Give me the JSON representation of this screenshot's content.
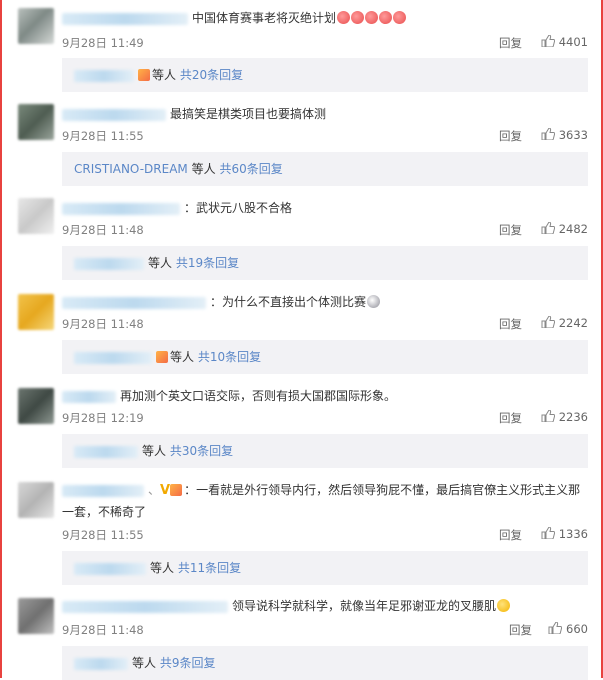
{
  "comments": [
    {
      "text": "中国体育赛事老将灭绝计划",
      "time": "9月28日 11:49",
      "reply_label": "回复",
      "likes": "4401",
      "sub": {
        "name": "",
        "suffix": "等人",
        "link": "共20条回复"
      }
    },
    {
      "text": "最搞笑是棋类项目也要搞体测",
      "time": "9月28日 11:55",
      "reply_label": "回复",
      "likes": "3633",
      "sub": {
        "name": "CRISTIANO-DREAM",
        "suffix": "等人",
        "link": "共60条回复"
      }
    },
    {
      "text": "：武状元八股不合格",
      "time": "9月28日 11:48",
      "reply_label": "回复",
      "likes": "2482",
      "sub": {
        "name": "",
        "suffix": "等人",
        "link": "共19条回复"
      }
    },
    {
      "text": "：为什么不直接出个体测比赛",
      "time": "9月28日 11:48",
      "reply_label": "回复",
      "likes": "2242",
      "sub": {
        "name": "",
        "suffix": "等人",
        "link": "共10条回复"
      }
    },
    {
      "text": "再加测个英文口语交际，否则有损大国郡国际形象。",
      "time": "9月28日 12:19",
      "reply_label": "回复",
      "likes": "2236",
      "sub": {
        "name": "",
        "suffix": "等人",
        "link": "共30条回复"
      }
    },
    {
      "text_line1": "：一看就是外行领导内行，然后领导狗屁不懂，最后搞官僚主义形式主义那",
      "text_line2": "一套，不稀奇了",
      "time": "9月28日 11:55",
      "reply_label": "回复",
      "likes": "1336",
      "sub": {
        "name": "",
        "suffix": "等人",
        "link": "共11条回复"
      }
    },
    {
      "text": "领导说科学就科学，就像当年足邪谢亚龙的叉腰肌",
      "time": "9月28日 11:48",
      "reply_label": "回复",
      "likes": "660",
      "sub": {
        "name": "",
        "suffix": "等人",
        "link": "共9条回复"
      }
    }
  ],
  "icons": {
    "like": "thumbs-up-icon",
    "badge": "level-badge-icon",
    "emoji": "emoji-icon"
  },
  "colors": {
    "link": "#5b87c7",
    "frame": "#e8423f",
    "sub_bg": "#f2f2f5"
  }
}
